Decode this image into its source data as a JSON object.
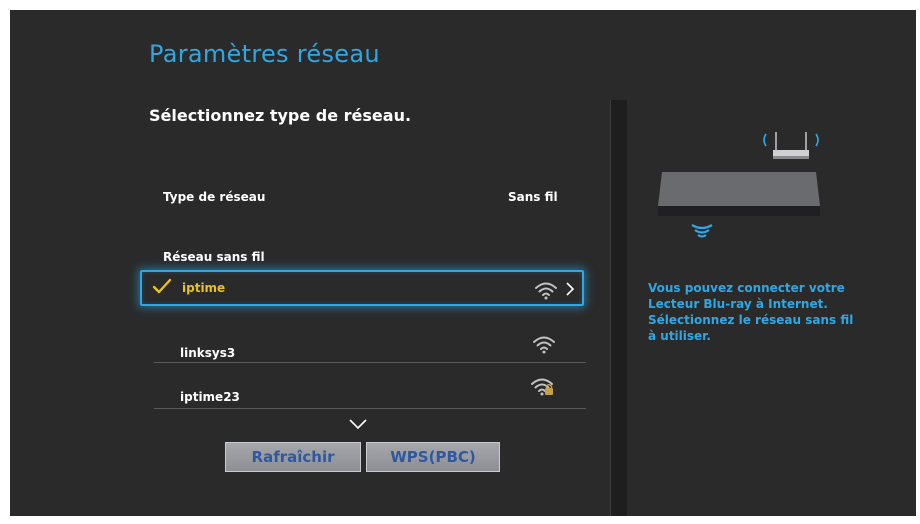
{
  "header": {
    "title": "Paramètres réseau",
    "subtitle": "Sélectionnez type de réseau."
  },
  "network_type": {
    "label": "Type de réseau",
    "value": "Sans fil"
  },
  "wireless_section": {
    "label": "Réseau sans fil"
  },
  "networks": [
    {
      "name": "iptime",
      "selected": true,
      "secured": false,
      "icon": "wifi-icon"
    },
    {
      "name": "linksys3",
      "selected": false,
      "secured": false,
      "icon": "wifi-icon"
    },
    {
      "name": "iptime23",
      "selected": false,
      "secured": true,
      "icon": "wifi-lock-icon"
    }
  ],
  "buttons": {
    "refresh": "Rafraîchir",
    "wps": "WPS(PBC)"
  },
  "info": {
    "text": "Vous pouvez connecter votre Lecteur Blu-ray à Internet. Sélectionnez le réseau sans fil à utiliser."
  },
  "colors": {
    "accent": "#2ea8e4",
    "selected_text": "#e8c21e",
    "background": "#2a2a2b",
    "button_text": "#2f58a0"
  }
}
